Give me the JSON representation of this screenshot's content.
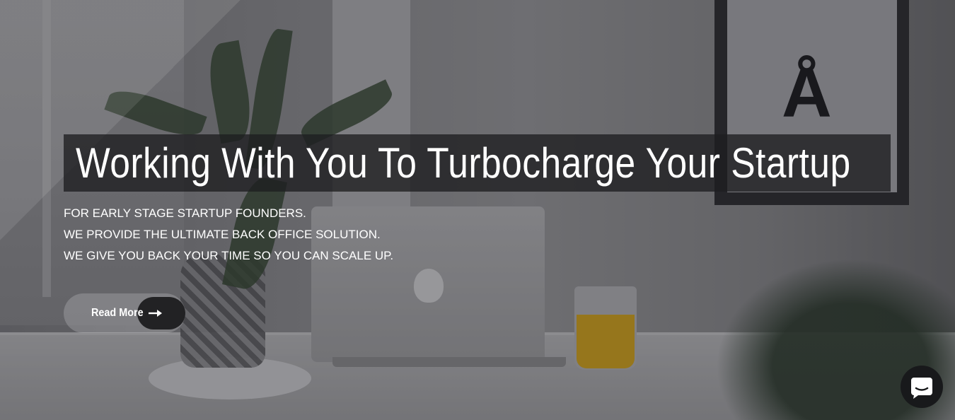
{
  "hero": {
    "title": "Working With You To Turbocharge Your Startup",
    "lines": [
      "FOR EARLY STAGE STARTUP FOUNDERS.",
      "WE PROVIDE THE ULTIMATE BACK OFFICE SOLUTION.",
      "WE GIVE YOU BACK YOUR TIME SO YOU CAN SCALE UP."
    ],
    "button_label": "Read More",
    "button_icon": "arrow-right-icon",
    "frame_letter": "Å"
  },
  "chat_widget": {
    "icon": "chat-bubble-icon"
  },
  "colors": {
    "headline_bg": "#1e1e20",
    "text": "#ffffff",
    "button_circle": "#222224",
    "chat_bg": "#18191b"
  }
}
